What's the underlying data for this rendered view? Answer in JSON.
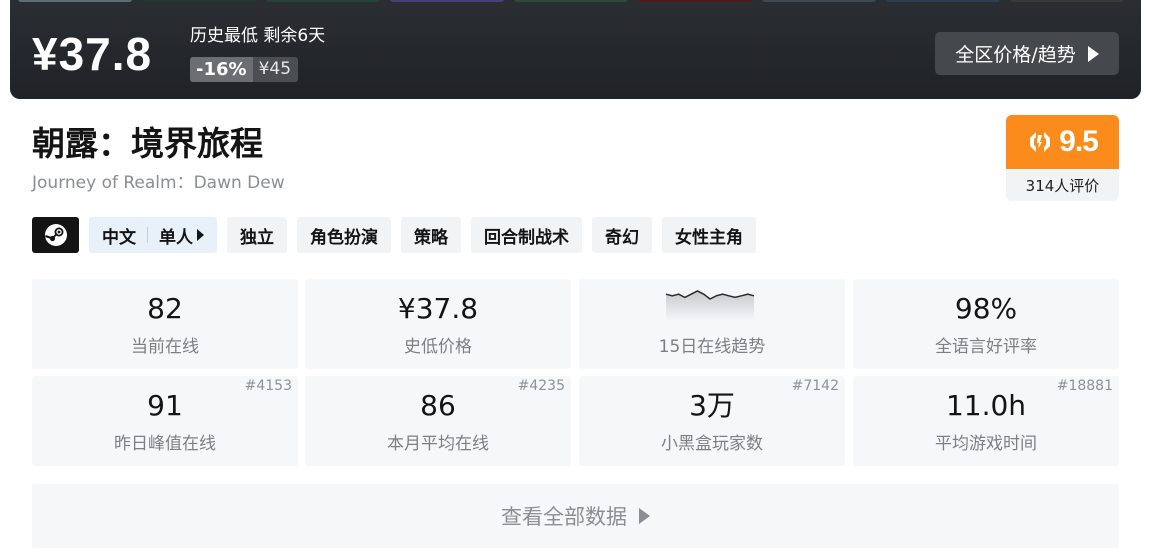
{
  "banner": {
    "price": "¥37.8",
    "lowest_label": "历史最低 剩余6天",
    "discount": "-16%",
    "original_price": "¥45",
    "region_button": "全区价格/趋势",
    "arrow_icon": "triangle-right-icon"
  },
  "game": {
    "title": "朝露：境界旅程",
    "subtitle": "Journey of Realm：Dawn Dew"
  },
  "score": {
    "value": "9.5",
    "reviews": "314人评价",
    "icon": "heybox-logo-icon",
    "color": "#fb8c1c"
  },
  "tags": {
    "platform_icon": "steam-icon",
    "language": "中文",
    "players": "单人",
    "items": [
      "独立",
      "角色扮演",
      "策略",
      "回合制战术",
      "奇幻",
      "女性主角"
    ]
  },
  "stats": {
    "current_online": {
      "value": "82",
      "label": "当前在线"
    },
    "lowest_price": {
      "value": "¥37.8",
      "label": "史低价格"
    },
    "trend": {
      "label": "15日在线趋势",
      "points": [
        15,
        14,
        15,
        13,
        15,
        17,
        15,
        12,
        14,
        15,
        14,
        13,
        14,
        15,
        14
      ]
    },
    "positive_rate": {
      "value": "98%",
      "label": "全语言好评率"
    },
    "peak_yesterday": {
      "value": "91",
      "label": "昨日峰值在线",
      "rank": "#4153"
    },
    "monthly_avg": {
      "value": "86",
      "label": "本月平均在线",
      "rank": "#4235"
    },
    "heybox_players": {
      "value": "3万",
      "label": "小黑盒玩家数",
      "rank": "#7142"
    },
    "avg_playtime": {
      "value": "11.0h",
      "label": "平均游戏时间",
      "rank": "#18881"
    }
  },
  "view_all": "查看全部数据",
  "colors": {
    "banner_bg": "#24272b",
    "score_orange": "#fb8c1c",
    "stat_bg": "#f6f7f9"
  }
}
